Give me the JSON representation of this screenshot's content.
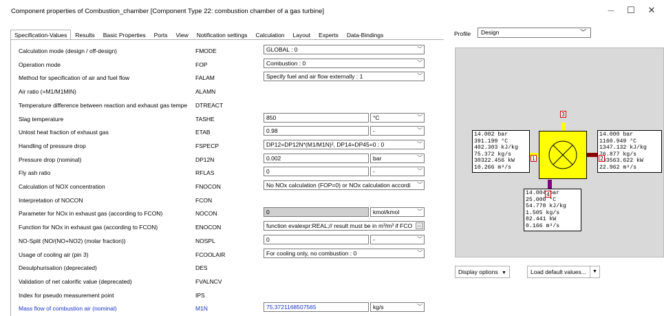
{
  "window": {
    "title": "Component properties of Combustion_chamber   [Component Type 22: combustion chamber of a gas turbine]",
    "minimize": "—",
    "maximize": "☐",
    "close": "✕"
  },
  "tabs": [
    "Specification-Values",
    "Results",
    "Basic Properties",
    "Ports",
    "View",
    "Notification settings",
    "Calculation",
    "Layout",
    "Experts",
    "Data-Bindings"
  ],
  "rows": [
    {
      "label": "Calculation mode (design / off-design)",
      "code": "FMODE",
      "value": "GLOBAL : 0",
      "unit": null
    },
    {
      "label": "Operation mode",
      "code": "FOP",
      "value": "Combustion : 0",
      "unit": null
    },
    {
      "label": "Method for specification of air and fuel flow",
      "code": "FALAM",
      "value": "Specify fuel and air flow externally : 1",
      "unit": null
    },
    {
      "label": "Air ratio (=M1/M1MIN)",
      "code": "ALAMN",
      "value": null,
      "unit": null
    },
    {
      "label": "Temperature difference between reaction and exhaust gas tempe",
      "code": "DTREACT",
      "value": null,
      "unit": null
    },
    {
      "label": "Slag temperature",
      "code": "TASHE",
      "value": "850",
      "unit": "°C"
    },
    {
      "label": "Unlost heat fraction of exhaust gas",
      "code": "ETAB",
      "value": "0.98",
      "unit": "-"
    },
    {
      "label": "Handling of pressure drop",
      "code": "FSPECP",
      "value": "DP12=DP12N*(M1/M1N)², DP14=DP45=0 : 0",
      "unit": null
    },
    {
      "label": "Pressure drop (nominal)",
      "code": "DP12N",
      "value": "0.002",
      "unit": "bar"
    },
    {
      "label": "Fly ash ratio",
      "code": "RFLAS",
      "value": "0",
      "unit": "-"
    },
    {
      "label": "Calculation of NOX concentration",
      "code": "FNOCON",
      "value": "No NOx calculation (FOP=0) or NOx calculation accordi",
      "unit": null
    },
    {
      "label": "Interpretation of NOCON",
      "code": "FCON",
      "value": null,
      "unit": null
    },
    {
      "label": "Parameter for NOx in exhaust gas (according to FCON)",
      "code": "NOCON",
      "value": "0",
      "unit": "kmol/kmol",
      "gray": true
    },
    {
      "label": "Function for NOx in exhaust gas (according to FCON)",
      "code": "ENOCON",
      "value": "function evalexpr:REAL;// result must be in m³/m³ if FCO",
      "unit": null,
      "ellipsis": true
    },
    {
      "label": "NO-Split (NO/(NO+NO2)  (molar fraction))",
      "code": "NOSPL",
      "value": "0",
      "unit": "-"
    },
    {
      "label": "Usage of cooling air (pin 3)",
      "code": "FCOOLAIR",
      "value": "For cooling only, no combustion : 0",
      "unit": null
    },
    {
      "label": "Desulphurisation (deprecated)",
      "code": "DES",
      "value": null,
      "unit": null
    },
    {
      "label": "Validation of net calorific value (deprecated)",
      "code": "FVALNCV",
      "value": null,
      "unit": null
    },
    {
      "label": "Index for pseudo measurement point",
      "code": "IPS",
      "value": null,
      "unit": null
    },
    {
      "label": "Mass flow of combustion air (nominal)",
      "code": "M1N",
      "value": "75.3721168507565",
      "unit": "kg/s",
      "blue": true
    }
  ],
  "profile": {
    "label": "Profile",
    "value": "Design"
  },
  "diagram": {
    "pin1": {
      "num": "1",
      "lines": [
        "14.002 bar",
        "391.199 °C",
        "402.303 kJ/kg",
        "75.372 kg/s",
        "30322.456 kW",
        "10.266 m³/s"
      ]
    },
    "pin2": {
      "num": "2",
      "lines": [
        "14.000 bar",
        "1160.949 °C",
        "1347.132 kJ/kg",
        "76.877 kg/s",
        "103563.622 kW",
        "22.962 m³/s"
      ]
    },
    "pin3": {
      "num": "3"
    },
    "pin4": {
      "num": "4",
      "lines": [
        "14.004 bar",
        "25.000 °C",
        "54.778 kJ/kg",
        "1.505 kg/s",
        "82.441 kW",
        "0.166 m³/s"
      ]
    }
  },
  "buttons": {
    "display": "Display options",
    "load": "Load default values..."
  },
  "colors": {
    "component": "#ffff00",
    "link_title": "#1a33c8",
    "pin2_line": "#8b0000",
    "pin4_line": "#800080"
  }
}
